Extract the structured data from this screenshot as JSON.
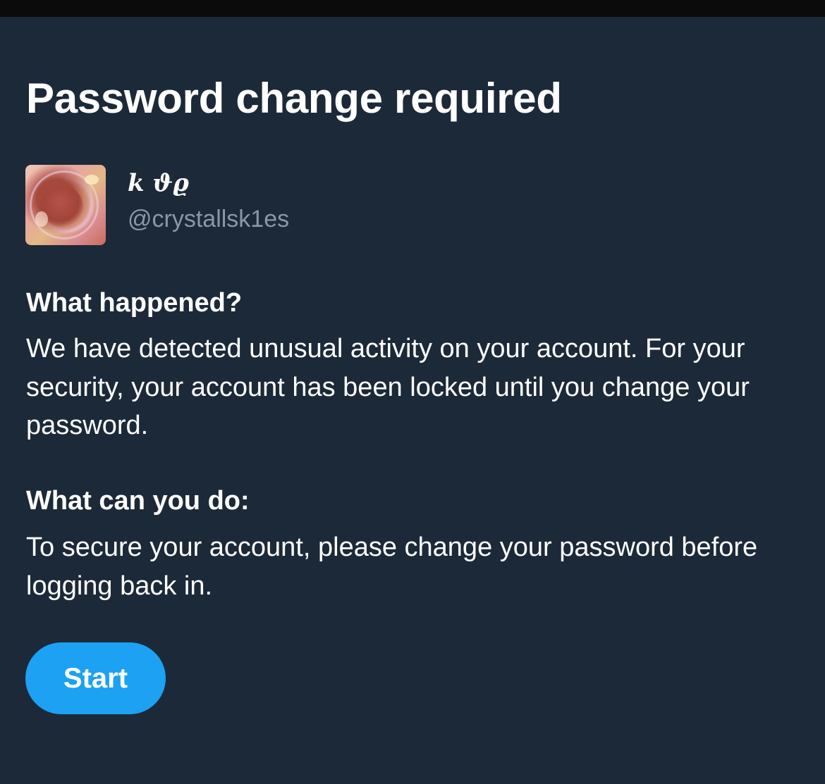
{
  "page": {
    "title": "Password change required",
    "background_color": "#1c2938",
    "accent_color": "#1da1f2"
  },
  "account": {
    "display_name": "𝒌 ϑϱ",
    "handle": "@crystallsk1es",
    "avatar": "profile-photo"
  },
  "sections": [
    {
      "heading": "What happened?",
      "body": "We have detected unusual activity on your account. For your security, your account has been locked until you change your password."
    },
    {
      "heading": "What can you do:",
      "body": "To secure your account, please change your password before logging back in."
    }
  ],
  "actions": {
    "start_label": "Start"
  }
}
